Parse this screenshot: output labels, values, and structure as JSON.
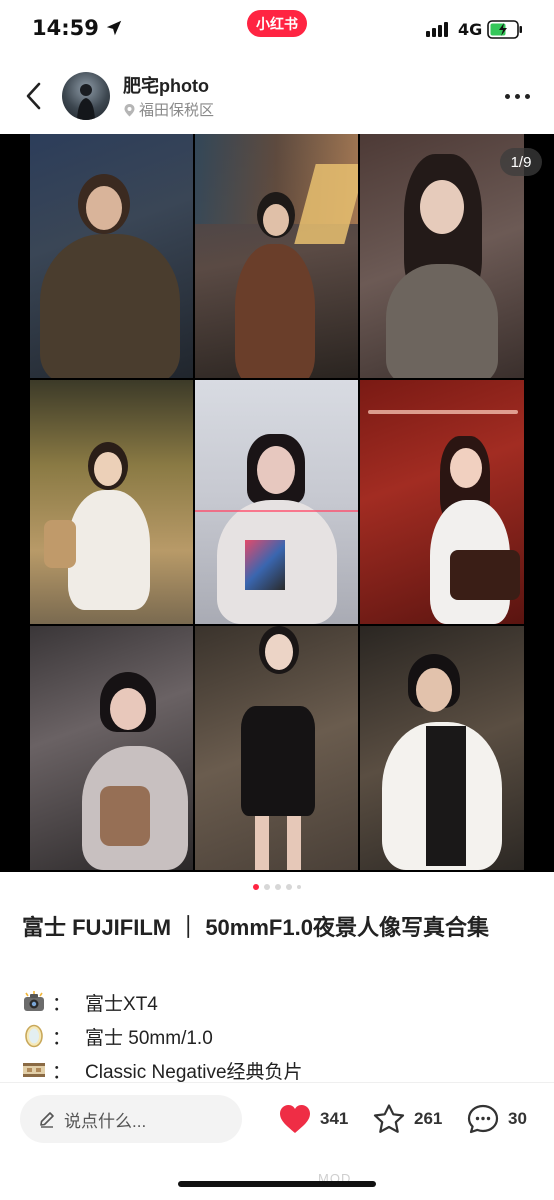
{
  "status_bar": {
    "time": "14:59",
    "app_badge": "小红书",
    "network": "4G"
  },
  "header": {
    "author_name": "肥宅photo",
    "location": "福田保税区"
  },
  "media": {
    "page_counter": "1/9",
    "total_dots": 5,
    "active_dot": 0
  },
  "post": {
    "title": "富士 FUJIFILM ｜ 50mmF1.0夜景人像写真合集",
    "meta": [
      {
        "icon": "camera-icon",
        "colon": "：",
        "text": "富士XT4"
      },
      {
        "icon": "lens-icon",
        "colon": "：",
        "text": "富士 50mm/1.0"
      },
      {
        "icon": "film-icon",
        "colon": "：",
        "text": "Classic Negative经典负片"
      }
    ]
  },
  "bottom_bar": {
    "comment_placeholder": "说点什么...",
    "likes": "341",
    "stars": "261",
    "comments": "30",
    "watermark": "MOD"
  },
  "colors": {
    "brand_red": "#ff2442",
    "like_red": "#ef2d45"
  }
}
